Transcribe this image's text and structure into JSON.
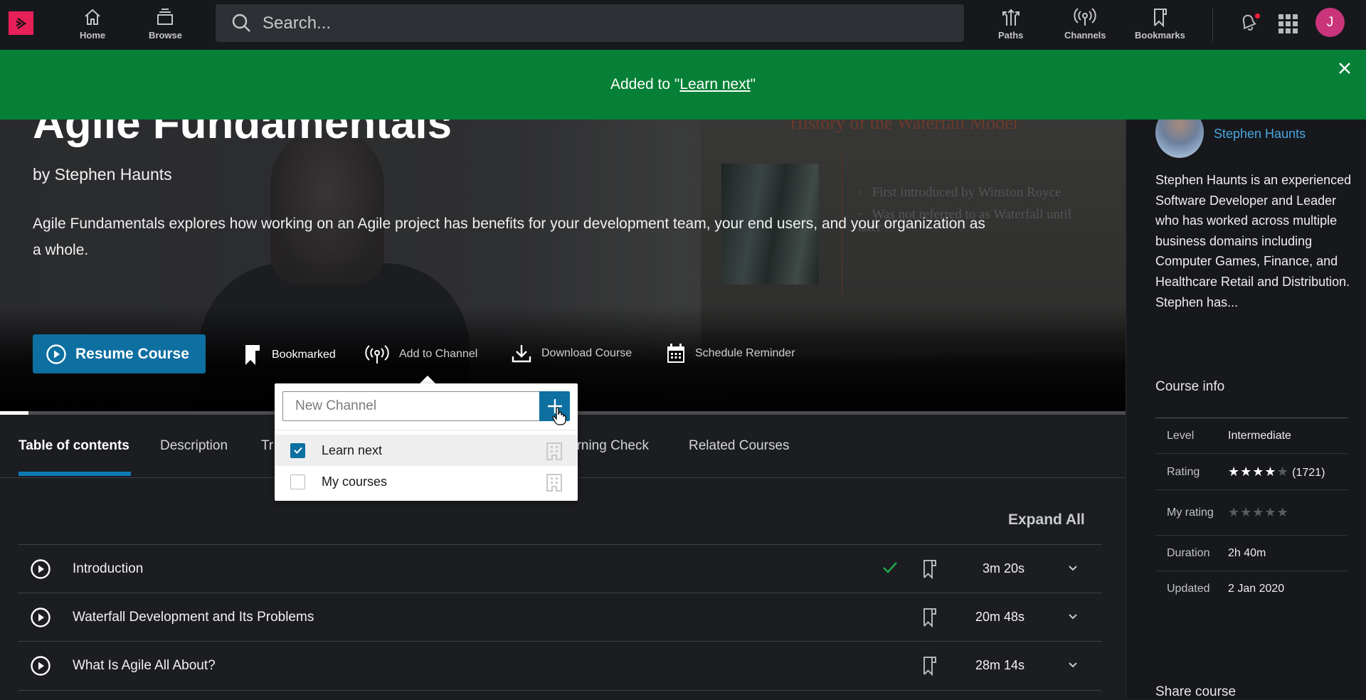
{
  "nav": {
    "home_label": "Home",
    "browse_label": "Browse",
    "search_placeholder": "Search...",
    "paths_label": "Paths",
    "channels_label": "Channels",
    "bookmarks_label": "Bookmarks",
    "avatar_initial": "J",
    "notification_dot": true
  },
  "toast": {
    "prefix": "Added to \"",
    "link": "Learn next",
    "suffix": "\"",
    "color": "#058036"
  },
  "hero": {
    "title": "Agile Fundamentals",
    "author_line": "by Stephen Haunts",
    "description": "Agile Fundamentals explores how working on an Agile project has benefits for your development team, your end users, and your organization as a whole.",
    "slide_title": "History of the Waterfall Model",
    "slide_bullets": [
      "First introduced by Winston Royce",
      "Was not referred to as Waterfall until later"
    ],
    "resume_label": "Resume Course",
    "actions": {
      "bookmarked": "Bookmarked",
      "add_to_channel": "Add to Channel",
      "download": "Download Course",
      "schedule": "Schedule Reminder"
    },
    "progress_percent": 2.5,
    "accent": "#0e6fa1"
  },
  "channel_popup": {
    "input_placeholder": "New Channel",
    "input_value": "",
    "items": [
      {
        "label": "Learn next",
        "checked": true
      },
      {
        "label": "My courses",
        "checked": false
      }
    ]
  },
  "tabs": [
    {
      "label": "Table of contents",
      "active": true
    },
    {
      "label": "Description",
      "active": false
    },
    {
      "label": "Tr",
      "active": false
    },
    {
      "label": "arning Check",
      "active": false
    },
    {
      "label": "Related Courses",
      "active": false
    }
  ],
  "toc": {
    "expand_all": "Expand All",
    "modules": [
      {
        "title": "Introduction",
        "duration": "3m 20s",
        "completed": true
      },
      {
        "title": "Waterfall Development and Its Problems",
        "duration": "20m 48s",
        "completed": false
      },
      {
        "title": "What Is Agile All About?",
        "duration": "28m 14s",
        "completed": false
      }
    ]
  },
  "sidebar": {
    "author_name": "Stephen Haunts",
    "author_bio": "Stephen Haunts is an experienced Software Developer and Leader who has worked across multiple business domains including Computer Games, Finance, and Healthcare Retail and Distribution. Stephen has...",
    "course_info_heading": "Course info",
    "info": {
      "level_label": "Level",
      "level": "Intermediate",
      "rating_label": "Rating",
      "rating_stars": 4,
      "rating_max": 5,
      "rating_count": "(1721)",
      "my_rating_label": "My rating",
      "my_rating_stars": 0,
      "duration_label": "Duration",
      "duration": "2h 40m",
      "updated_label": "Updated",
      "updated": "2 Jan 2020"
    },
    "share_heading": "Share course"
  }
}
